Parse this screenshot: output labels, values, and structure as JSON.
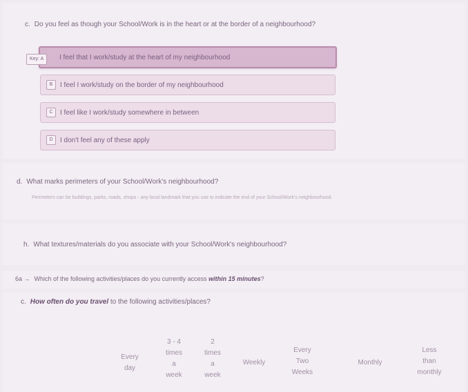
{
  "q_c": {
    "letter": "c.",
    "text": "Do you feel as though your School/Work is in the heart or at the border of a neighbourhood?",
    "key_badge": "Key: A",
    "options": [
      {
        "key": "A",
        "label": "I feel that I work/study at the heart of my neighbourhood",
        "selected": true
      },
      {
        "key": "B",
        "label": "I feel I work/study on the border of my neighbourhood",
        "selected": false
      },
      {
        "key": "C",
        "label": "I feel like I work/study somewhere in between",
        "selected": false
      },
      {
        "key": "D",
        "label": "I don't feel any of these apply",
        "selected": false
      }
    ]
  },
  "q_d": {
    "letter": "d.",
    "text": "What marks perimeters of your School/Work's neighbourhood?",
    "hint": "Perimeters can be buildings, parks, roads, shops - any local landmark that you use to indicate the end of your School/Work's neighbourhood."
  },
  "q_h": {
    "letter": "h.",
    "text": "What textures/materials do you associate with your School/Work's neighbourhood?"
  },
  "q_6a": {
    "letter": "6a →",
    "text_before": "Which of the following activities/places do you currently access ",
    "text_emph": "within 15 minutes",
    "text_after": "?"
  },
  "q_c2": {
    "letter": "c.",
    "text_emph": "How often do you travel",
    "text_after": " to the following activities/places?",
    "columns": [
      [
        "Every",
        "day"
      ],
      [
        "3 - 4",
        "times",
        "a",
        "week"
      ],
      [
        "2",
        "times",
        "a",
        "week"
      ],
      [
        "Weekly"
      ],
      [
        "Every",
        "Two",
        "Weeks"
      ],
      [
        "Monthly"
      ],
      [
        "Less",
        "than",
        "monthly"
      ]
    ]
  },
  "colors": {
    "background": "#efe9f0",
    "option_fill": "#ecdde9",
    "selected_fill": "#d7b6cf",
    "text": "#7a647e"
  }
}
